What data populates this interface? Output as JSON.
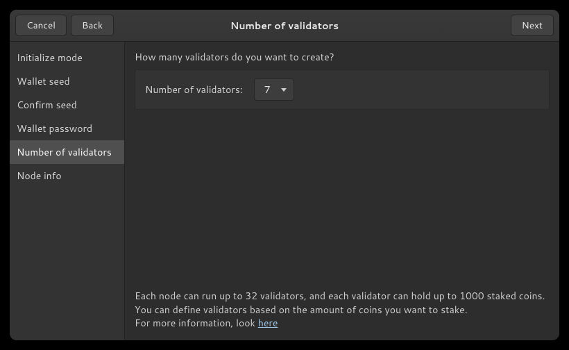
{
  "header": {
    "cancel": "Cancel",
    "back": "Back",
    "title": "Number of validators",
    "next": "Next"
  },
  "sidebar": {
    "items": [
      {
        "label": "Initialize mode",
        "active": false
      },
      {
        "label": "Wallet seed",
        "active": false
      },
      {
        "label": "Confirm seed",
        "active": false
      },
      {
        "label": "Wallet password",
        "active": false
      },
      {
        "label": "Number of validators",
        "active": true
      },
      {
        "label": "Node info",
        "active": false
      }
    ]
  },
  "main": {
    "question": "How many validators do you want to create?",
    "field_label": "Number of validators:",
    "selected_value": "7"
  },
  "footer": {
    "line1": "Each node can run up to 32 validators, and each validator can hold up to 1000 staked coins.",
    "line2": "You can define validators based on the amount of coins you want to stake.",
    "line3_prefix": "For more information, look ",
    "link_text": "here"
  }
}
